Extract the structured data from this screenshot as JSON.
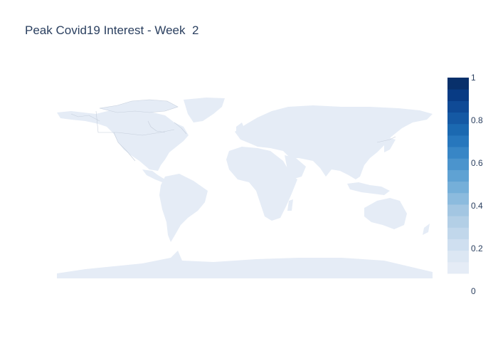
{
  "title": "Peak Covid19 Interest - Week  2",
  "colorbar": {
    "colorscale_name": "Blues",
    "colors": [
      "#e5ecf6",
      "#dce7f3",
      "#cfdff0",
      "#c1d7eb",
      "#b3cfe6",
      "#a3c6e2",
      "#8cbbde",
      "#75afd9",
      "#5fa2d3",
      "#4b94cd",
      "#3886c6",
      "#2777bd",
      "#1b69b1",
      "#1559a4",
      "#0f4a96",
      "#083b84",
      "#08306b"
    ],
    "min": 0,
    "max": 1,
    "ticks": [
      "0",
      "0.2",
      "0.4",
      "0.6",
      "0.8",
      "1"
    ]
  },
  "map": {
    "projection": "equirectangular",
    "land_color": "#e5ecf6",
    "border_color": "#c6cfdc",
    "values_shown": "none"
  }
}
